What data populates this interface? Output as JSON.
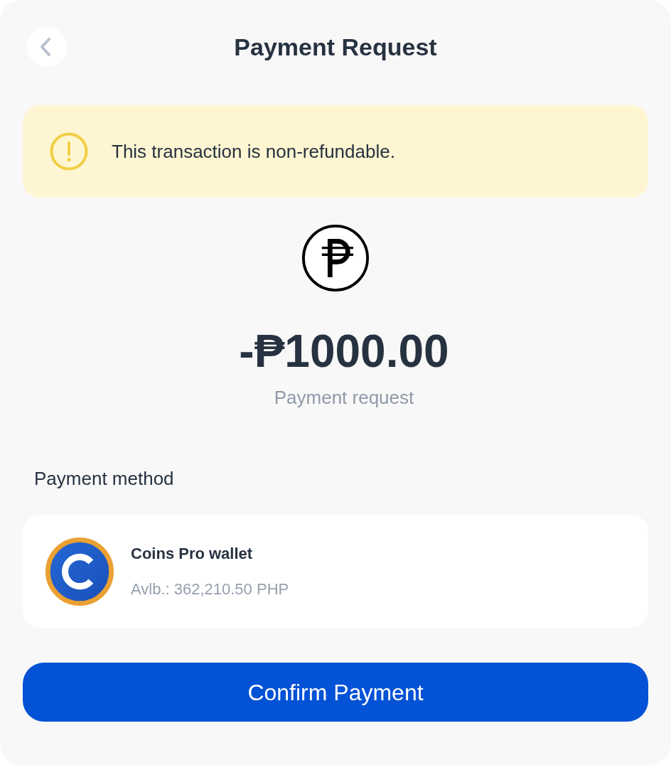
{
  "header": {
    "title": "Payment Request"
  },
  "notice": {
    "text": "This transaction is non-refundable."
  },
  "amount": {
    "value": "-₱1000.00",
    "caption": "Payment request"
  },
  "payment_method": {
    "label": "Payment method",
    "wallet": {
      "name": "Coins Pro wallet",
      "balance": "Avlb.: 362,210.50 PHP"
    }
  },
  "confirm_button": {
    "label": "Confirm Payment"
  }
}
